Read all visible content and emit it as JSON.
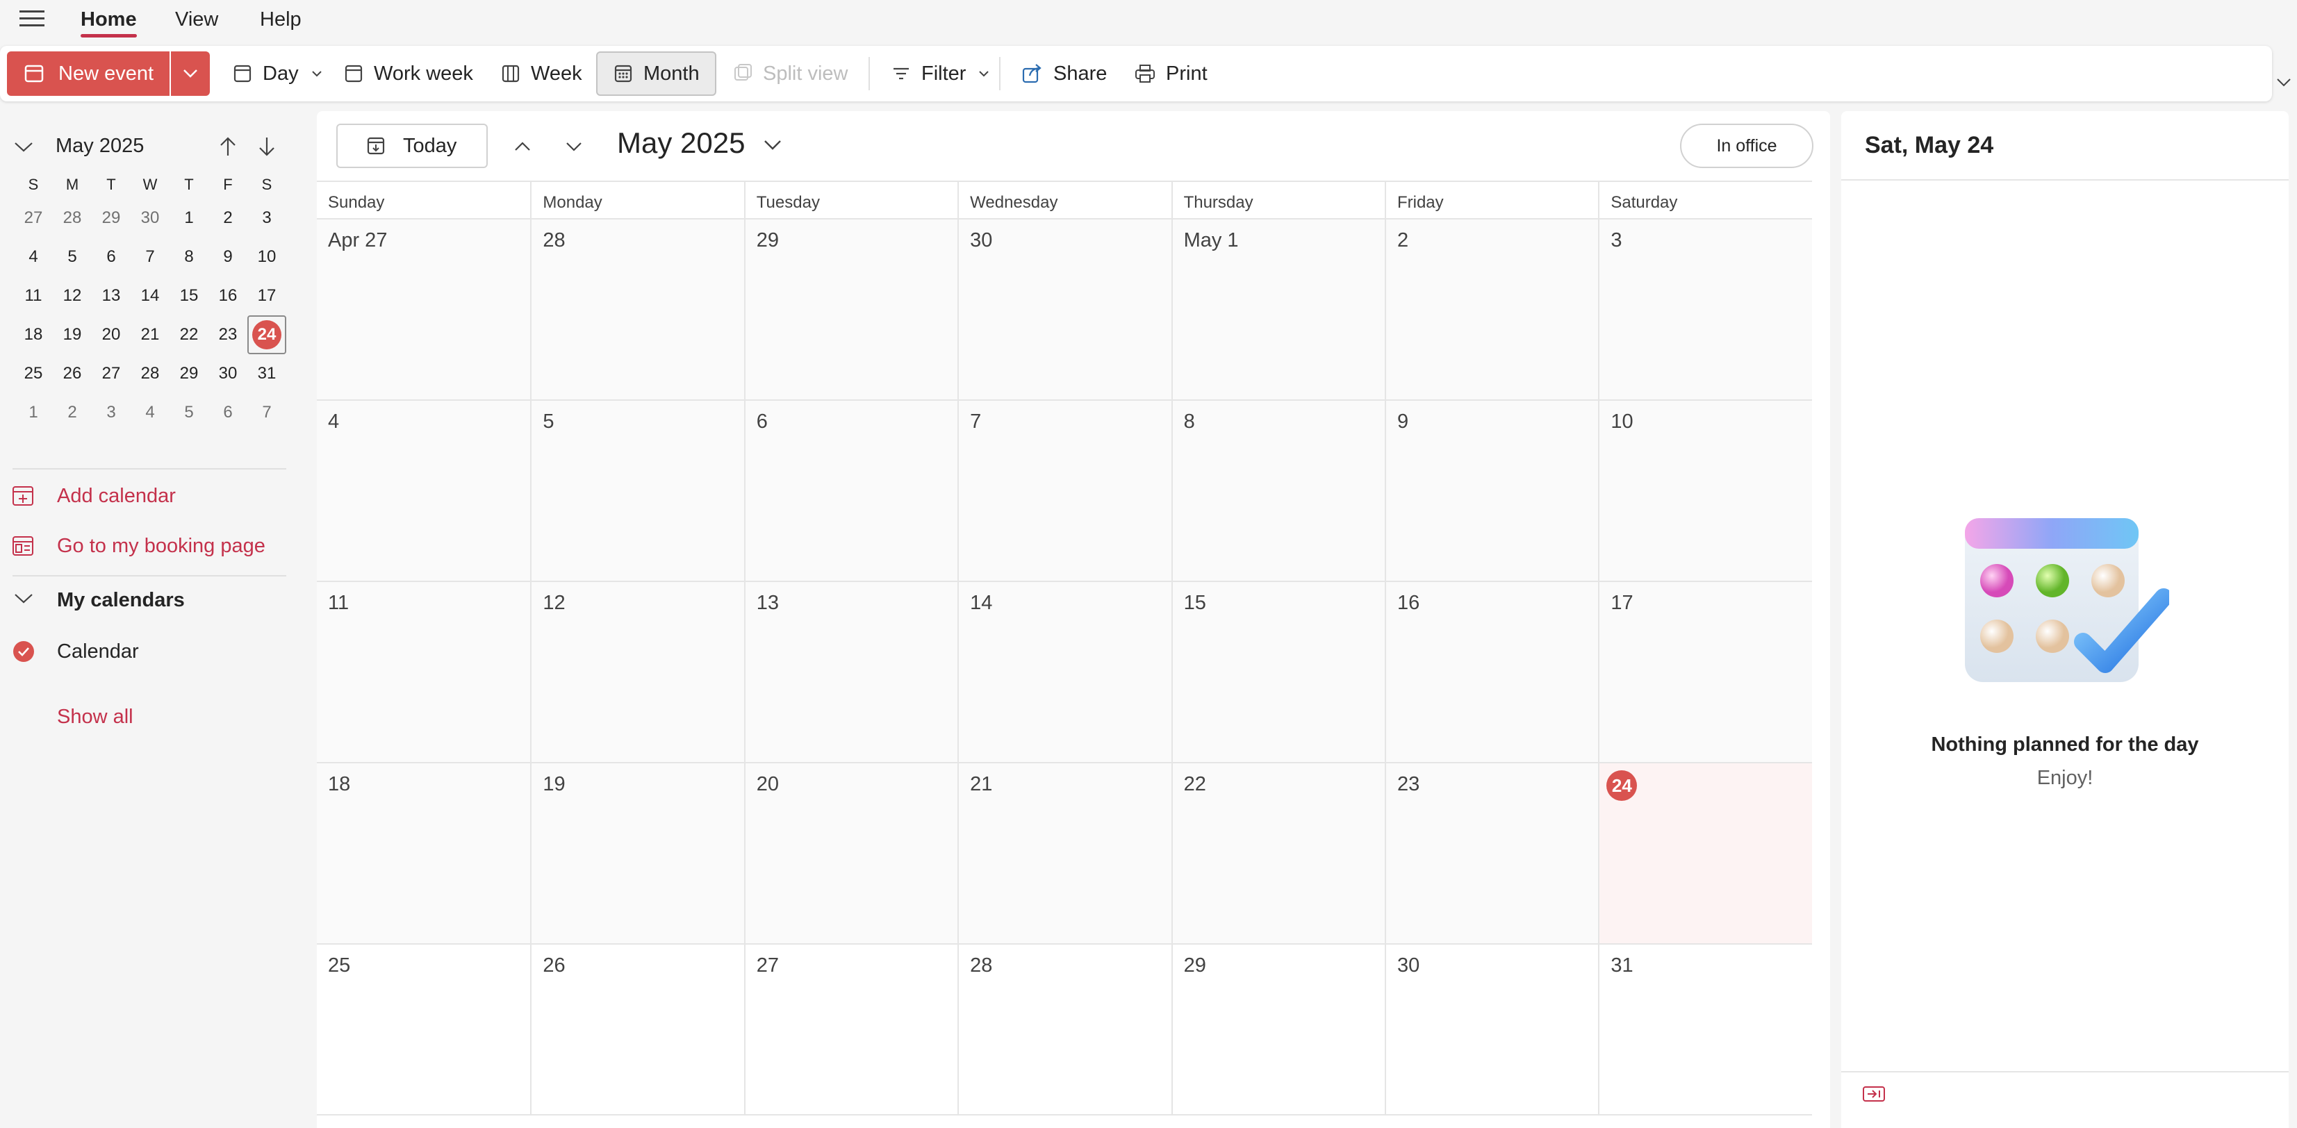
{
  "menu": {
    "tabs": [
      {
        "label": "Home",
        "active": true
      },
      {
        "label": "View"
      },
      {
        "label": "Help"
      }
    ]
  },
  "ribbon": {
    "new_event": "New event",
    "day": "Day",
    "work_week": "Work week",
    "week": "Week",
    "month": "Month",
    "split_view": "Split view",
    "filter": "Filter",
    "share": "Share",
    "print": "Print"
  },
  "mini_calendar": {
    "title": "May 2025",
    "weekdays": [
      "S",
      "M",
      "T",
      "W",
      "T",
      "F",
      "S"
    ],
    "weeks": [
      [
        "27",
        "28",
        "29",
        "30",
        "1",
        "2",
        "3"
      ],
      [
        "4",
        "5",
        "6",
        "7",
        "8",
        "9",
        "10"
      ],
      [
        "11",
        "12",
        "13",
        "14",
        "15",
        "16",
        "17"
      ],
      [
        "18",
        "19",
        "20",
        "21",
        "22",
        "23",
        "24"
      ],
      [
        "25",
        "26",
        "27",
        "28",
        "29",
        "30",
        "31"
      ],
      [
        "1",
        "2",
        "3",
        "4",
        "5",
        "6",
        "7"
      ]
    ],
    "selected": "24"
  },
  "left": {
    "add_calendar": "Add calendar",
    "booking_page": "Go to my booking page",
    "my_calendars": "My calendars",
    "calendar_name": "Calendar",
    "show_all": "Show all"
  },
  "calendar": {
    "today_label": "Today",
    "title": "May 2025",
    "in_office": "In office",
    "days_of_week": [
      "Sunday",
      "Monday",
      "Tuesday",
      "Wednesday",
      "Thursday",
      "Friday",
      "Saturday"
    ],
    "weeks": [
      [
        "Apr 27",
        "28",
        "29",
        "30",
        "May 1",
        "2",
        "3"
      ],
      [
        "4",
        "5",
        "6",
        "7",
        "8",
        "9",
        "10"
      ],
      [
        "11",
        "12",
        "13",
        "14",
        "15",
        "16",
        "17"
      ],
      [
        "18",
        "19",
        "20",
        "21",
        "22",
        "23",
        "24"
      ],
      [
        "25",
        "26",
        "27",
        "28",
        "29",
        "30",
        "31"
      ]
    ],
    "today": "24"
  },
  "right_pane": {
    "title": "Sat, May 24",
    "empty_title": "Nothing planned for the day",
    "empty_sub": "Enjoy!"
  },
  "colors": {
    "accent": "#d9534f",
    "accent_text": "#c4314b"
  }
}
